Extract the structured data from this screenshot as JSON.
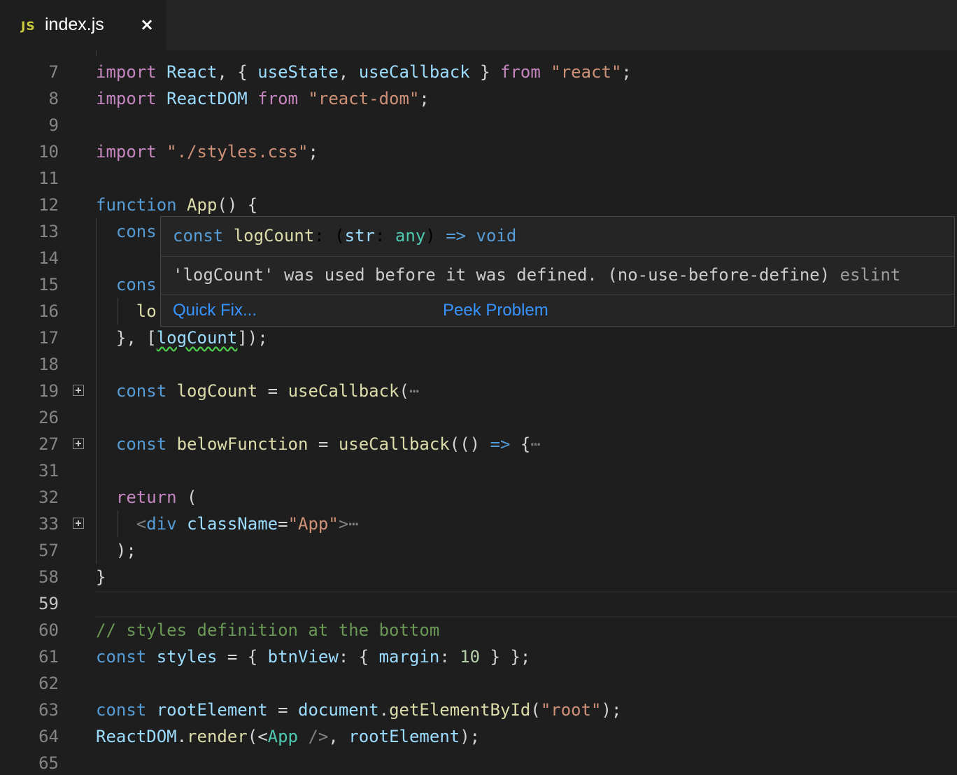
{
  "tab": {
    "icon_label": "JS",
    "filename": "index.js",
    "close_glyph": "×",
    "icon": "close-icon"
  },
  "code": {
    "l7": {
      "n": "7",
      "t1": "import",
      "t2": "React",
      "t3": ", { ",
      "t4": "useState",
      "t5": ", ",
      "t6": "useCallback",
      "t7": " } ",
      "t8": "from",
      "t9": "\"react\"",
      "t10": ";"
    },
    "l8": {
      "n": "8",
      "t1": "import",
      "t2": "ReactDOM",
      "t3": "from",
      "t4": "\"react-dom\"",
      "t5": ";"
    },
    "l9": {
      "n": "9"
    },
    "l10": {
      "n": "10",
      "t1": "import",
      "t2": "\"./styles.css\"",
      "t3": ";"
    },
    "l11": {
      "n": "11"
    },
    "l12": {
      "n": "12",
      "t1": "function",
      "t2": "App",
      "t3": "() {"
    },
    "l13": {
      "n": "13",
      "t1": "cons"
    },
    "l14": {
      "n": "14"
    },
    "l15": {
      "n": "15",
      "t1": "cons"
    },
    "l16": {
      "n": "16",
      "t1": "lo"
    },
    "l17": {
      "n": "17",
      "t1": "}, [",
      "t2": "logCount",
      "t3": "]);"
    },
    "l18": {
      "n": "18"
    },
    "l19": {
      "n": "19",
      "t1": "const",
      "t2": "logCount",
      "t3": " = ",
      "t4": "useCallback",
      "t5": "(",
      "t6": "⋯"
    },
    "l26": {
      "n": "26"
    },
    "l27": {
      "n": "27",
      "t1": "const",
      "t2": "belowFunction",
      "t3": " = ",
      "t4": "useCallback",
      "t5": "(() ",
      "t6": "=>",
      "t7": " {",
      "t8": "⋯"
    },
    "l31": {
      "n": "31"
    },
    "l32": {
      "n": "32",
      "t1": "return",
      "t2": " ("
    },
    "l33": {
      "n": "33",
      "t1": "<",
      "t2": "div",
      "t3": "className",
      "t4": "=",
      "t5": "\"App\"",
      "t6": ">",
      "t7": "⋯"
    },
    "l57": {
      "n": "57",
      "t1": ");"
    },
    "l58": {
      "n": "58",
      "t1": "}"
    },
    "l59": {
      "n": "59"
    },
    "l60": {
      "n": "60",
      "t1": "// styles definition at the bottom"
    },
    "l61": {
      "n": "61",
      "t1": "const",
      "t2": "styles",
      "t3": " = { ",
      "t4": "btnView",
      "t5": ": { ",
      "t6": "margin",
      "t7": ": ",
      "t8": "10",
      "t9": " } };"
    },
    "l62": {
      "n": "62"
    },
    "l63": {
      "n": "63",
      "t1": "const",
      "t2": "rootElement",
      "t3": " = ",
      "t4": "document",
      "t5": ".",
      "t6": "getElementById",
      "t7": "(",
      "t8": "\"root\"",
      "t9": ");"
    },
    "l64": {
      "n": "64",
      "t1": "ReactDOM",
      "t2": ".",
      "t3": "render",
      "t4": "(<",
      "t5": "App",
      "t6": " />",
      "t7": ", ",
      "t8": "rootElement",
      "t9": ");"
    },
    "l65": {
      "n": "65"
    }
  },
  "hover": {
    "sig": {
      "k": "const",
      "name": "logCount",
      "p1": ": (",
      "param": "str",
      "p2": ": ",
      "type": "any",
      "p3": ") ",
      "arrow": "=>",
      "ret": "void"
    },
    "message": "'logCount' was used before it was defined. (no-use-before-define)",
    "source": "eslint",
    "quick_fix": "Quick Fix...",
    "peek_problem": "Peek Problem"
  },
  "colors": {
    "keyword": "#c586c0",
    "storage": "#569cd6",
    "variable": "#9cdcfe",
    "function": "#dcdcaa",
    "string": "#ce9178",
    "comment": "#6a9955",
    "link": "#3794ff"
  }
}
